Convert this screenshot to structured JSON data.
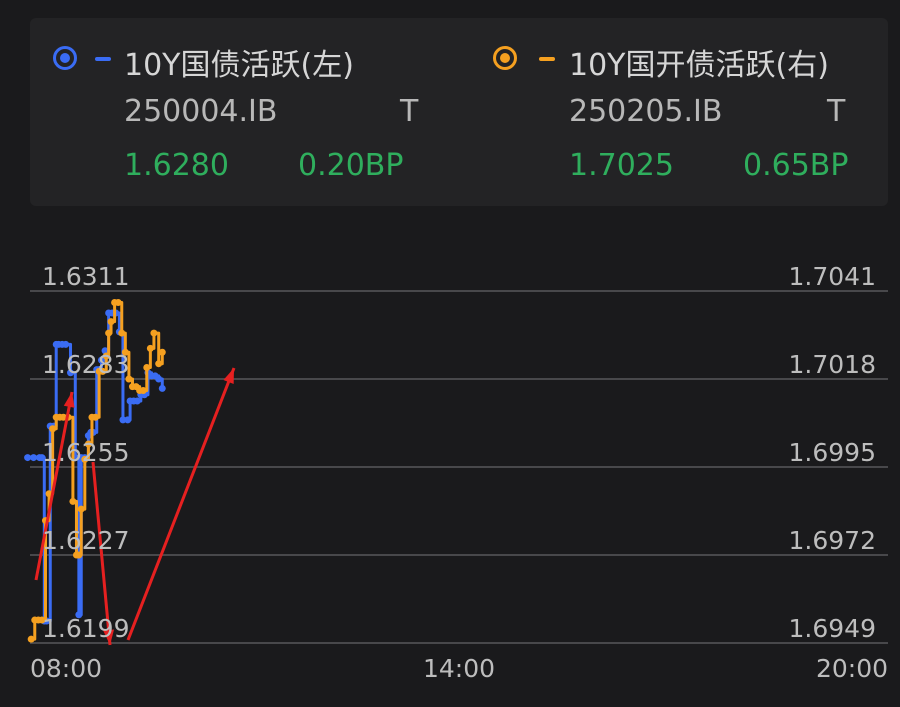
{
  "legend": {
    "series": [
      {
        "name": "10Y国债活跃(左)",
        "code": "250004.IB",
        "flag": "T",
        "value": "1.6280",
        "change": "0.20BP",
        "color": "#3a6cf4"
      },
      {
        "name": "10Y国开债活跃(右)",
        "code": "250205.IB",
        "flag": "T",
        "value": "1.7025",
        "change": "0.65BP",
        "color": "#f5a020"
      }
    ],
    "value_color": "#2fae5d"
  },
  "chart_data": {
    "type": "line",
    "x_ticks": [
      "08:00",
      "14:00",
      "20:00"
    ],
    "left_ticks": [
      "1.6311",
      "1.6283",
      "1.6255",
      "1.6227",
      "1.6199"
    ],
    "right_ticks": [
      "1.7041",
      "1.7018",
      "1.6995",
      "1.6972",
      "1.6949"
    ],
    "left_ylim": [
      1.6199,
      1.6311
    ],
    "right_ylim": [
      1.6949,
      1.7041
    ],
    "grid": true,
    "series": [
      {
        "name": "10Y国债活跃(左)",
        "axis": "left",
        "color": "#3a6cf4",
        "x": [
          "07:58",
          "08:03",
          "08:08",
          "08:10",
          "08:12",
          "08:14",
          "08:17",
          "08:20",
          "08:22",
          "08:24",
          "08:27",
          "08:30",
          "08:34",
          "08:38",
          "08:41",
          "08:43",
          "08:46",
          "08:49",
          "08:51",
          "08:53",
          "08:56",
          "08:58",
          "09:00",
          "09:03",
          "09:06",
          "09:09",
          "09:12",
          "09:15",
          "09:18",
          "09:22",
          "09:24",
          "09:27",
          "09:30",
          "09:33",
          "09:36",
          "09:39",
          "09:42",
          "09:45",
          "09:48",
          "09:51"
        ],
        "y": [
          1.6258,
          1.6258,
          1.6258,
          1.6258,
          1.6206,
          1.6206,
          1.6268,
          1.6268,
          1.6294,
          1.6294,
          1.6294,
          1.6294,
          1.6285,
          1.6258,
          1.6208,
          1.6258,
          1.6258,
          1.6265,
          1.6266,
          1.6266,
          1.6286,
          1.6286,
          1.6289,
          1.6292,
          1.6304,
          1.6304,
          1.6304,
          1.6298,
          1.627,
          1.627,
          1.6276,
          1.6276,
          1.6276,
          1.6278,
          1.6278,
          1.6285,
          1.6284,
          1.6284,
          1.6283,
          1.628
        ]
      },
      {
        "name": "10Y国开债活跃(右)",
        "axis": "right",
        "color": "#f5a020",
        "x": [
          "08:01",
          "08:04",
          "08:07",
          "08:10",
          "08:13",
          "08:16",
          "08:19",
          "08:22",
          "08:25",
          "08:28",
          "08:32",
          "08:36",
          "08:39",
          "08:41",
          "08:43",
          "08:46",
          "08:49",
          "08:52",
          "08:55",
          "08:58",
          "09:01",
          "09:04",
          "09:06",
          "09:08",
          "09:11",
          "09:14",
          "09:17",
          "09:20",
          "09:23",
          "09:26",
          "09:29",
          "09:32",
          "09:35",
          "09:38",
          "09:41",
          "09:44",
          "09:48",
          "09:51"
        ],
        "y": [
          1.695,
          1.6955,
          1.6955,
          1.6955,
          1.6981,
          1.6988,
          1.7005,
          1.7008,
          1.7008,
          1.7008,
          1.7008,
          1.6986,
          1.6972,
          1.6972,
          1.6984,
          1.6997,
          1.7001,
          1.7008,
          1.7008,
          1.702,
          1.702,
          1.7024,
          1.703,
          1.7033,
          1.7038,
          1.7038,
          1.703,
          1.7025,
          1.7018,
          1.7016,
          1.7016,
          1.7015,
          1.7015,
          1.7021,
          1.7026,
          1.703,
          1.7022,
          1.7025
        ]
      }
    ],
    "annotation_color": "#e62020"
  }
}
